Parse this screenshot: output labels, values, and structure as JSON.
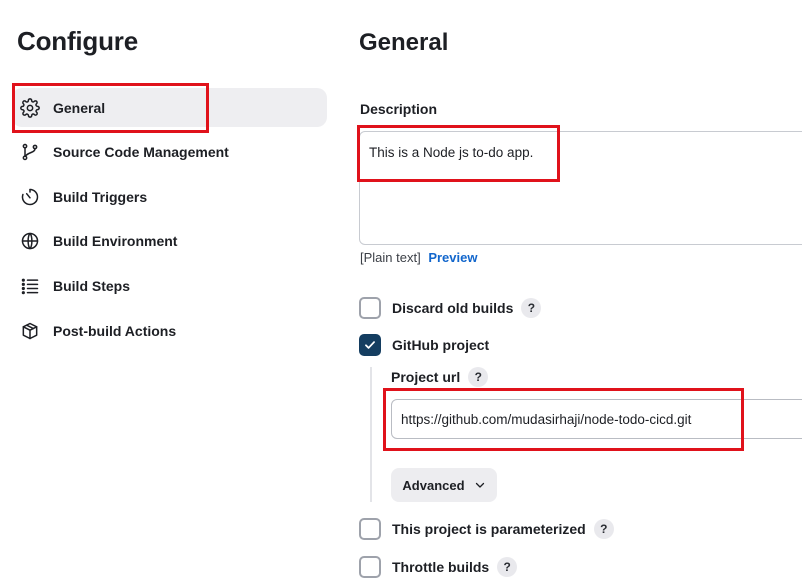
{
  "sidebar": {
    "title": "Configure",
    "items": [
      {
        "label": "General",
        "icon": "gear-icon",
        "active": true
      },
      {
        "label": "Source Code Management",
        "icon": "branch-icon",
        "active": false
      },
      {
        "label": "Build Triggers",
        "icon": "timer-icon",
        "active": false
      },
      {
        "label": "Build Environment",
        "icon": "globe-icon",
        "active": false
      },
      {
        "label": "Build Steps",
        "icon": "list-icon",
        "active": false
      },
      {
        "label": "Post-build Actions",
        "icon": "package-icon",
        "active": false
      }
    ]
  },
  "main": {
    "title": "General",
    "description": {
      "label": "Description",
      "value": "This is a Node js to-do app.",
      "format_note": "[Plain text]",
      "preview_link": "Preview"
    },
    "options": {
      "discard_old_builds": {
        "label": "Discard old builds",
        "checked": false,
        "help": "?"
      },
      "github_project": {
        "label": "GitHub project",
        "checked": true,
        "help": "?",
        "project_url_label": "Project url",
        "project_url_value": "https://github.com/mudasirhaji/node-todo-cicd.git",
        "advanced_label": "Advanced"
      },
      "parameterized": {
        "label": "This project is parameterized",
        "checked": false,
        "help": "?"
      },
      "throttle_builds": {
        "label": "Throttle builds",
        "checked": false,
        "help": "?"
      }
    }
  },
  "colors": {
    "highlight": "#e0121b",
    "checkbox_checked": "#143d60",
    "link": "#1266cc",
    "active_bg": "#eeeef1"
  }
}
